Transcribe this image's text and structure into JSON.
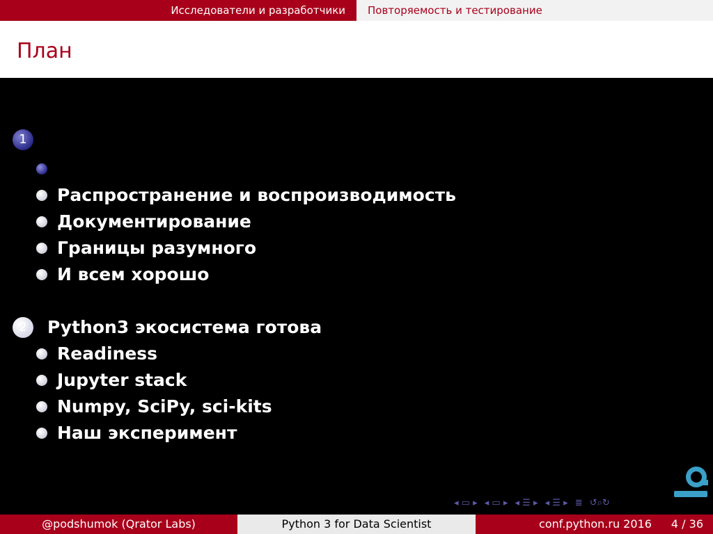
{
  "header": {
    "sections": [
      {
        "label": "Исследователи и разработчики",
        "active": true
      },
      {
        "label": "Повторяемость и тестирование",
        "active": false
      }
    ]
  },
  "frame": {
    "title": "План"
  },
  "outline": [
    {
      "number": "1",
      "title": "",
      "items": [
        {
          "label": "",
          "active": true
        },
        {
          "label": "Распространение и воспроизводимость",
          "active": false
        },
        {
          "label": "Документирование",
          "active": false
        },
        {
          "label": "Границы разумного",
          "active": false
        },
        {
          "label": "И всем хорошо",
          "active": false
        }
      ]
    },
    {
      "number": "2",
      "title": "Python3 экосистема готова",
      "items": [
        {
          "label": "Readiness",
          "active": false
        },
        {
          "label": "Jupyter stack",
          "active": false
        },
        {
          "label": "Numpy, SciPy, sci-kits",
          "active": false
        },
        {
          "label": "Наш эксперимент",
          "active": false
        }
      ]
    }
  ],
  "logo": {
    "icon": "qrator-logo-icon",
    "color": "#3aa0c8"
  },
  "nav_icons": [
    "prev-frame-icon",
    "next-frame-icon",
    "prev-subsection-icon",
    "next-subsection-icon",
    "prev-section-icon",
    "next-section-icon",
    "align-icon",
    "search-icon"
  ],
  "footer": {
    "author": "@podshumok (Qrator Labs)",
    "talk": "Python 3 for Data Scientist",
    "venue": "conf.python.ru 2016",
    "page": "4 / 36"
  },
  "colors": {
    "accent": "#a8001a",
    "background": "#000000",
    "nav_gray": "#f2f2f2",
    "bullet_blue": "#2a2a8a"
  }
}
